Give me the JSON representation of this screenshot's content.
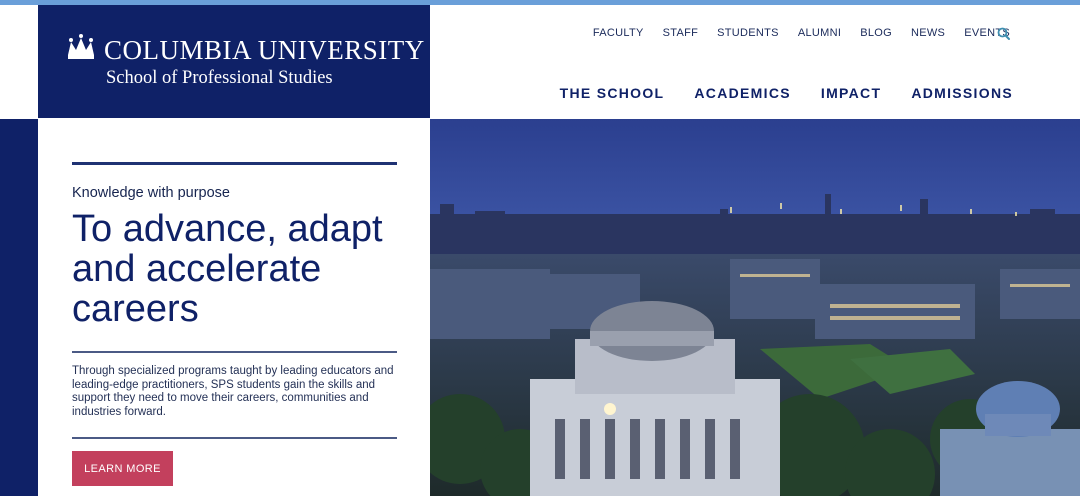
{
  "brand": {
    "title": "COLUMBIA UNIVERSITY",
    "subtitle": "School of Professional Studies",
    "color": "#0f2167"
  },
  "utility_nav": [
    "FACULTY",
    "STAFF",
    "STUDENTS",
    "ALUMNI",
    "BLOG",
    "NEWS",
    "EVENTS"
  ],
  "main_nav": [
    "THE SCHOOL",
    "ACADEMICS",
    "IMPACT",
    "ADMISSIONS"
  ],
  "hero": {
    "tagline": "Knowledge with purpose",
    "headline": "To advance, adapt and accelerate careers",
    "body": "Through specialized programs taught by leading educators and leading-edge practitioners, SPS students gain the skills and support they need to move their careers, communities and industries forward.",
    "cta_label": "LEARN MORE",
    "cta_color": "#c3405d"
  },
  "icons": {
    "search": "search-icon",
    "crown": "crown-icon"
  }
}
